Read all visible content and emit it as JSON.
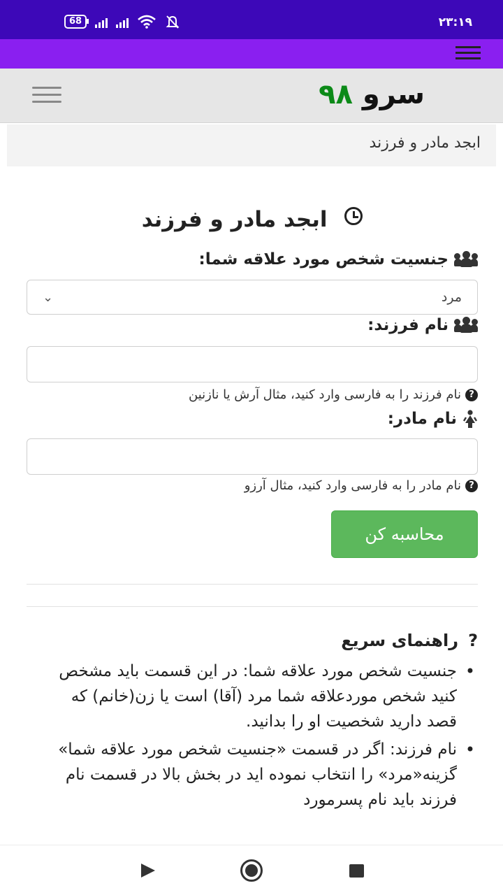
{
  "status_bar": {
    "time": "۲۳:۱۹",
    "battery": "68"
  },
  "site": {
    "logo_word": "سرو",
    "logo_number": "۹۸"
  },
  "breadcrumb": "ابجد مادر و فرزند",
  "page_title": "ابجد مادر و فرزند",
  "form": {
    "gender_label": "جنسیت شخص مورد علاقه شما:",
    "gender_value": "مرد",
    "child_label": "نام فرزند:",
    "child_value": "",
    "child_help": "نام فرزند را به فارسی وارد کنید، مثال آرش یا نازنین",
    "mother_label": "نام مادر:",
    "mother_value": "",
    "mother_help": "نام مادر را به فارسی وارد کنید، مثال آرزو",
    "submit_label": "محاسبه کن"
  },
  "guide": {
    "title": "راهنمای سریع",
    "items": [
      "جنسیت شخص مورد علاقه شما: در این قسمت باید مشخص کنید شخص موردعلاقه شما مرد (آقا) است یا زن(خانم) که قصد دارید شخصیت او را بدانید.",
      "نام فرزند: اگر در قسمت «جنسیت شخص مورد علاقه شما» گزینه«مرد» را انتخاب نموده اید در بخش بالا در قسمت نام فرزند باید نام پسرمورد"
    ]
  },
  "colors": {
    "status_bar": "#3d08b8",
    "app_bar": "#8a1ff0",
    "logo_number": "#0c8a18",
    "button": "#5cb85c"
  },
  "icons": [
    "battery-icon",
    "signal-icon",
    "wifi-icon",
    "mute-icon",
    "menu-icon",
    "clock-icon",
    "users-icon",
    "female-icon",
    "question-icon",
    "back-icon",
    "home-icon",
    "recent-apps-icon"
  ]
}
